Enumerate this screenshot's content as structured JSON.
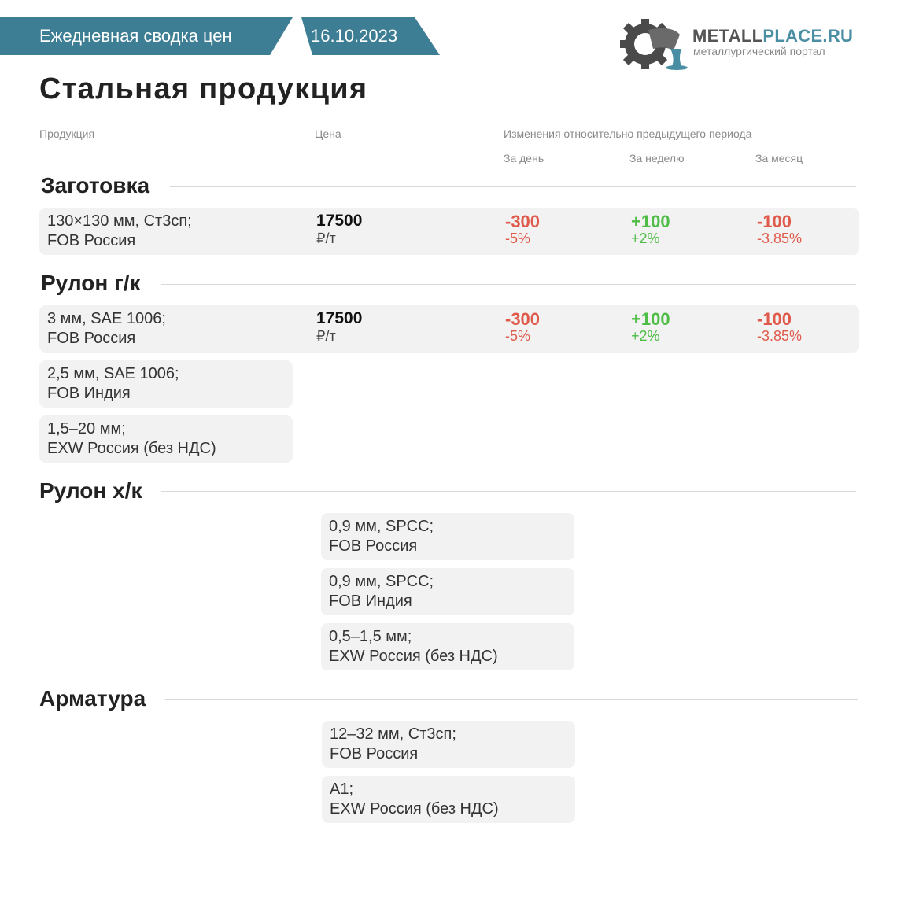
{
  "header": {
    "title": "Ежедневная сводка цен",
    "date": "16.10.2023",
    "logo_name_a": "METALL",
    "logo_name_b": "PLACE.RU",
    "logo_sub": "металлургический портал"
  },
  "page_title": "Стальная продукция",
  "columns": {
    "product": "Продукция",
    "price": "Цена",
    "changes": "Изменения относительно предыдущего периода",
    "day": "За день",
    "week": "За неделю",
    "month": "За месяц"
  },
  "sections": [
    {
      "title": "Заготовка",
      "items": [
        {
          "line1": "130×130 мм, Ст3сп;",
          "line2": "FOB Россия",
          "price": "17500",
          "unit": "₽/т",
          "day": "-300",
          "day_pct": "-5%",
          "week": "+100",
          "week_pct": "+2%",
          "month": "-100",
          "month_pct": "-3.85%"
        }
      ]
    },
    {
      "title": "Рулон г/к",
      "items": [
        {
          "line1": "3 мм, SAE 1006;",
          "line2": "FOB Россия",
          "price": "17500",
          "unit": "₽/т",
          "day": "-300",
          "day_pct": "-5%",
          "week": "+100",
          "week_pct": "+2%",
          "month": "-100",
          "month_pct": "-3.85%"
        },
        {
          "line1": "2,5 мм, SAE 1006;",
          "line2": "FOB Индия"
        },
        {
          "line1": "1,5–20 мм;",
          "line2": "EXW Россия (без НДС)"
        }
      ]
    },
    {
      "title": "Рулон х/к",
      "items": [
        {
          "line1": "0,9 мм, SPCC;",
          "line2": "FOB Россия"
        },
        {
          "line1": "0,9 мм, SPCC;",
          "line2": "FOB Индия"
        },
        {
          "line1": "0,5–1,5 мм;",
          "line2": "EXW Россия (без НДС)"
        }
      ]
    },
    {
      "title": "Арматура",
      "items": [
        {
          "line1": "12–32 мм, Ст3сп;",
          "line2": "FOB Россия"
        },
        {
          "line1": "A1;",
          "line2": "EXW Россия (без НДС)"
        }
      ]
    }
  ],
  "colors": {
    "accent": "#3d7e94",
    "negative": "#e05a4c",
    "positive": "#4dbd45"
  }
}
